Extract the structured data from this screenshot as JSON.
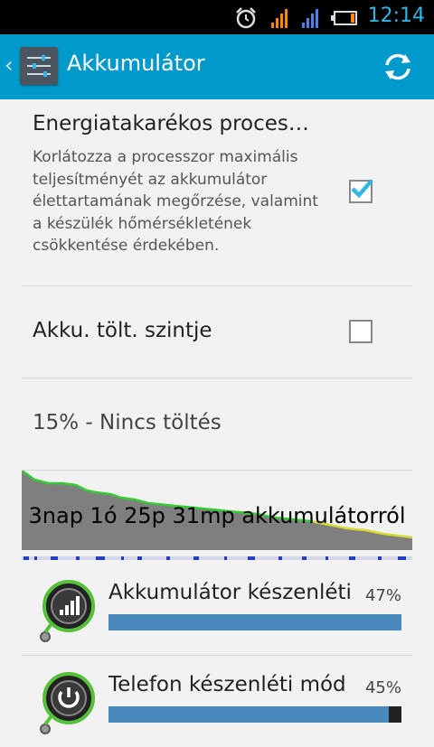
{
  "status_bar": {
    "time": "12:14",
    "icons": [
      "alarm-icon",
      "signal-icon-1",
      "signal-icon-2",
      "battery-low-icon"
    ]
  },
  "action_bar": {
    "title": "Akkumulátor",
    "app_icon": "sliders-icon",
    "refresh_icon": "refresh-icon",
    "back_icon": "chevron-left-icon"
  },
  "settings": {
    "power_saving": {
      "title": "Energiatakarékos proces…",
      "summary": "Korlátozza a processzor maximális teljesítményét az akkumulátor élettartamának megőrzése, valamint a készülék hőmérsékletének csökkentése érdekében.",
      "checked": true
    },
    "charge_level": {
      "label": "Akku. tölt. szintje",
      "checked": false
    },
    "status_line": "15% - Nincs töltés"
  },
  "graph": {
    "overlay_text": "3nap 1ó 25p 31mp akkumulátorról",
    "fill_color": "#7a7a7a",
    "line_color": "#33cc33"
  },
  "usage": [
    {
      "name": "Akkumulátor készenléti",
      "percent": "47%",
      "percent_value": 47,
      "icon": "signal-bars-icon"
    },
    {
      "name": "Telefon készenléti mód",
      "percent": "45%",
      "percent_value": 45,
      "icon": "power-icon"
    }
  ],
  "colors": {
    "action_bar": "#0099cc",
    "accent": "#33b5e5",
    "bar": "#4a89bd"
  }
}
